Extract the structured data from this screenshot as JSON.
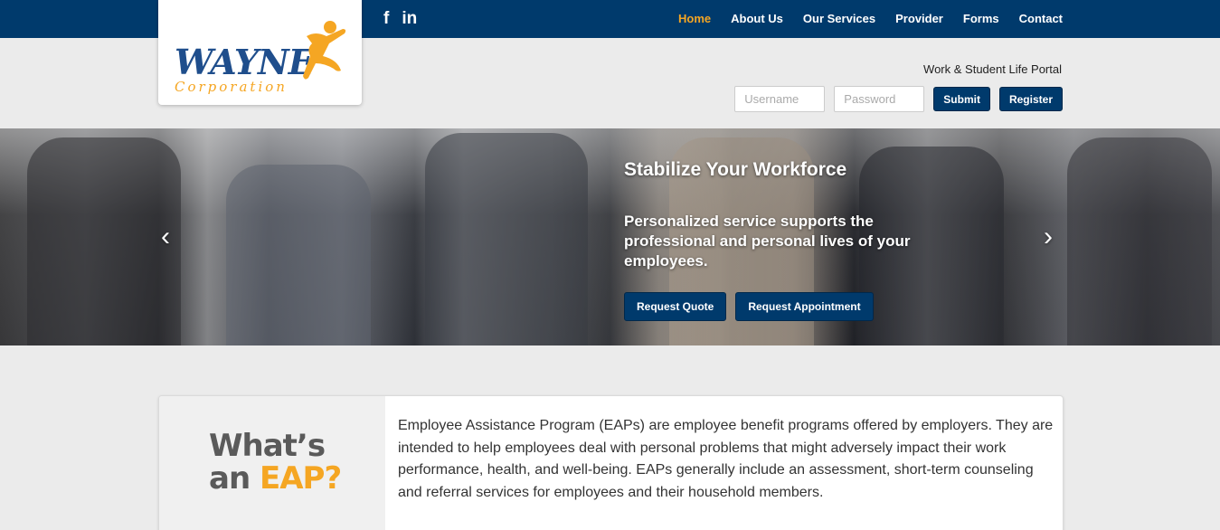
{
  "brand": {
    "logo_text": "WAYNE",
    "logo_sub": "Corporation",
    "accent": "#f5a623",
    "navy": "#003a6c"
  },
  "social": {
    "facebook": "f",
    "linkedin": "in"
  },
  "nav": {
    "home": "Home",
    "about": "About Us",
    "services": "Our Services",
    "provider": "Provider",
    "forms": "Forms",
    "contact": "Contact"
  },
  "portal": {
    "title": "Work & Student Life Portal",
    "username_placeholder": "Username",
    "password_placeholder": "Password",
    "submit_label": "Submit",
    "register_label": "Register"
  },
  "hero": {
    "title": "Stabilize Your Workforce",
    "subtitle": "Personalized service supports the professional and personal lives of your employees.",
    "quote_label": "Request Quote",
    "appointment_label": "Request Appointment",
    "prev_arrow": "‹",
    "next_arrow": "›"
  },
  "eap": {
    "heading_part1": "What’s",
    "heading_part2": "an",
    "heading_accent": "EAP?",
    "body": "Employee Assistance Program (EAPs) are employee benefit programs offered by employers. They are intended to help employees deal with personal problems that might adversely impact their work performance, health, and well-being. EAPs generally include an assessment, short-term counseling and referral services for employees and their household members."
  }
}
